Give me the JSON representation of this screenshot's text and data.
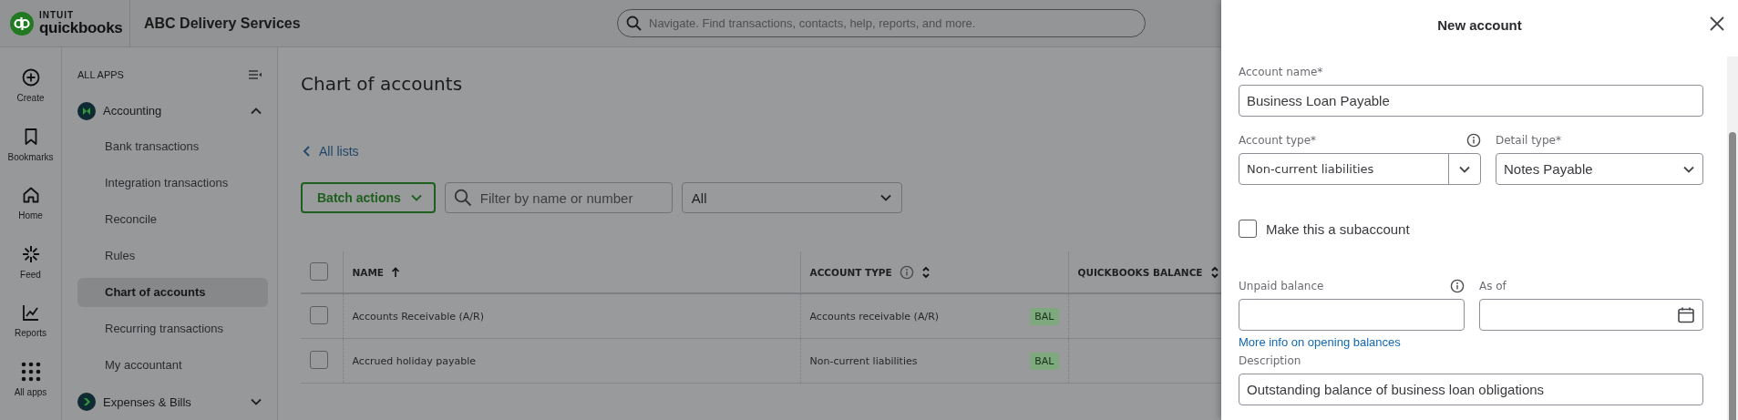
{
  "app_header": {
    "logo_brand": "INTUIT",
    "logo_product": "quickbooks",
    "company": "ABC Delivery Services",
    "search": {
      "placeholder": "Navigate. Find transactions, contacts, help, reports, and more."
    }
  },
  "rail": [
    {
      "label": "Create",
      "kind": "create"
    },
    {
      "label": "Bookmarks",
      "kind": "bookmarks"
    },
    {
      "label": "Home",
      "kind": "home"
    },
    {
      "label": "Feed",
      "kind": "feed"
    },
    {
      "label": "Reports",
      "kind": "reports"
    },
    {
      "label": "All apps",
      "kind": "apps"
    }
  ],
  "nav": {
    "heading": "ALL APPS",
    "sections": [
      {
        "label": "Accounting",
        "expanded": true,
        "children": [
          {
            "label": "Bank transactions",
            "selected": false
          },
          {
            "label": "Integration transactions",
            "selected": false
          },
          {
            "label": "Reconcile",
            "selected": false
          },
          {
            "label": "Rules",
            "selected": false
          },
          {
            "label": "Chart of accounts",
            "selected": true
          },
          {
            "label": "Recurring transactions",
            "selected": false
          },
          {
            "label": "My accountant",
            "selected": false
          }
        ]
      },
      {
        "label": "Expenses & Bills",
        "expanded": false
      }
    ]
  },
  "page": {
    "title": "Chart of accounts",
    "back_link": "All lists",
    "batch_button": "Batch actions",
    "filter": {
      "placeholder": "Filter by name or number"
    },
    "type_filter": {
      "value": "All"
    }
  },
  "table": {
    "select_all_checked": false,
    "columns": [
      {
        "label": "NAME",
        "kind": "sorted"
      },
      {
        "label": "ACCOUNT TYPE",
        "info": true,
        "kind": "sortable"
      },
      {
        "label": "QUICKBOOKS BALANCE",
        "kind": "sortable"
      }
    ],
    "rows": [
      {
        "checked": false,
        "name": "Accounts Receivable (A/R)",
        "account_type": "Accounts receivable (A/R)",
        "badge": "BAL"
      },
      {
        "checked": false,
        "name": "Accrued holiday payable",
        "account_type": "Non-current liabilities",
        "badge": "BAL"
      }
    ]
  },
  "drawer": {
    "title": "New account",
    "account_name": {
      "label": "Account name*",
      "value": "Business Loan Payable"
    },
    "account_type": {
      "label": "Account type*",
      "info": true,
      "value": "Non-current liabilities"
    },
    "detail_type": {
      "label": "Detail type*",
      "value": "Notes Payable"
    },
    "subaccount": {
      "label": "Make this a subaccount",
      "checked": false
    },
    "unpaid_balance": {
      "label": "Unpaid balance",
      "info": true
    },
    "as_of": {
      "label": "As of"
    },
    "link": "More info on opening balances",
    "description": {
      "label": "Description",
      "value": "Outstanding balance of business loan obligations"
    }
  }
}
